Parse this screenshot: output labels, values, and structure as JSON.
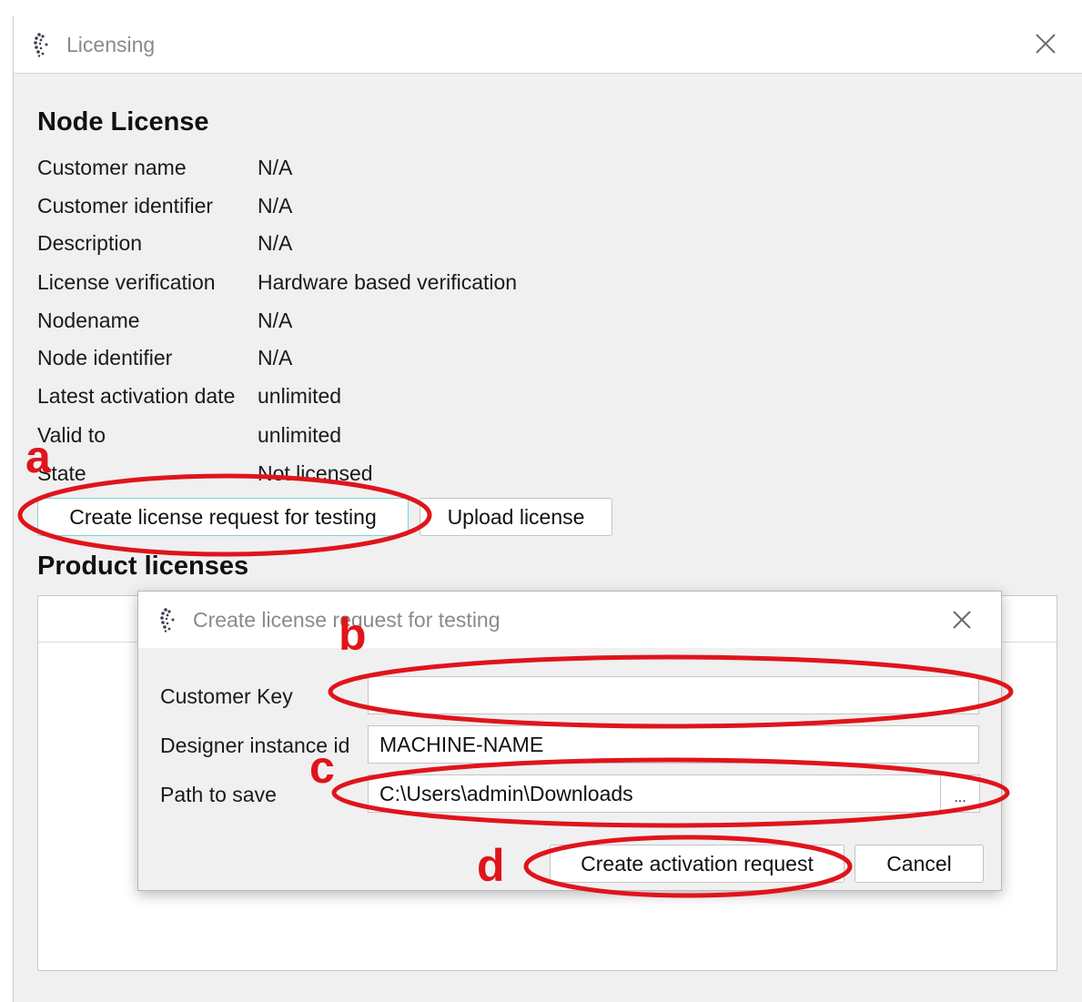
{
  "main_window": {
    "title": "Licensing",
    "node_license": {
      "heading": "Node License",
      "rows": [
        {
          "label": "Customer name",
          "value": "N/A"
        },
        {
          "label": "Customer identifier",
          "value": "N/A"
        },
        {
          "label": "Description",
          "value": "N/A"
        },
        {
          "label": "License verification",
          "value": "Hardware based verification"
        },
        {
          "label": "Nodename",
          "value": "N/A"
        },
        {
          "label": "Node identifier",
          "value": "N/A"
        },
        {
          "label": "Latest activation date",
          "value": "unlimited"
        },
        {
          "label": "Valid to",
          "value": "unlimited"
        },
        {
          "label": "State",
          "value": "Not licensed"
        }
      ],
      "create_request_button": "Create license request for testing",
      "upload_button": "Upload license"
    },
    "product_licenses": {
      "heading": "Product licenses"
    }
  },
  "dialog": {
    "title": "Create license request for testing",
    "customer_key": {
      "label": "Customer Key",
      "value": ""
    },
    "designer_instance": {
      "label": "Designer instance id",
      "value": "MACHINE-NAME"
    },
    "path_to_save": {
      "label": "Path to save",
      "value": "C:\\Users\\admin\\Downloads"
    },
    "browse_label": "...",
    "create_button": "Create activation request",
    "cancel_button": "Cancel"
  },
  "annotations": {
    "a": "a",
    "b": "b",
    "c": "c",
    "d": "d",
    "color": "#e0141b"
  },
  "icons": {
    "app": "app-logo-icon",
    "close": "close-icon"
  }
}
